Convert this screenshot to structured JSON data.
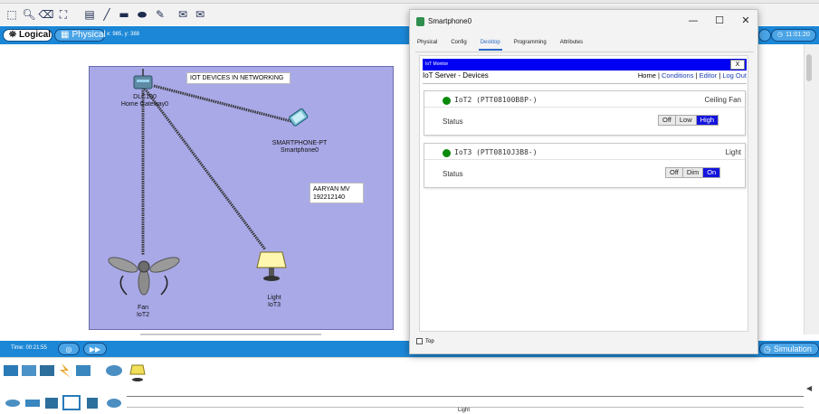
{
  "workspace": {
    "tabs": {
      "logical": "Logical",
      "physical": "Physical"
    },
    "coords": "x: 985, y: 388",
    "clock": "11:01:20",
    "title_note": "IOT DEVICES IN NETWORKING",
    "name_note": [
      "AARYAN MV",
      "192212140"
    ],
    "devices": {
      "gateway": {
        "type": "DLC100",
        "name": "Home Gateway0"
      },
      "smartphone": {
        "type": "SMARTPHONE-PT",
        "name": "Smartphone0"
      },
      "fan": {
        "type": "Fan",
        "name": "IoT2"
      },
      "light": {
        "type": "Light",
        "name": "IoT3"
      }
    }
  },
  "bottom_bar": {
    "time": "Time: 00:21:55",
    "mode": "Simulation"
  },
  "palette": {
    "selected_label": "Light"
  },
  "phone_window": {
    "title": "Smartphone0",
    "controls": {
      "minimize": "—",
      "maximize": "☐",
      "close": "✕"
    },
    "tabs": [
      "Physical",
      "Config",
      "Desktop",
      "Programming",
      "Attributes"
    ],
    "active_tab": "Desktop",
    "top_checkbox_label": "Top",
    "iot_monitor": {
      "title": "IoT Monitor",
      "close": "X",
      "header": "IoT Server - Devices",
      "nav": {
        "home": "Home",
        "conditions": "Conditions",
        "editor": "Editor",
        "logout": "Log Out"
      },
      "devices": [
        {
          "name": "IoT2 (PTT08100B8P-)",
          "type": "Ceiling Fan",
          "status_label": "Status",
          "options": [
            "Off",
            "Low",
            "High"
          ],
          "selected": "High"
        },
        {
          "name": "IoT3 (PTT0810J3B8-)",
          "type": "Light",
          "status_label": "Status",
          "options": [
            "Off",
            "Dim",
            "On"
          ],
          "selected": "On"
        }
      ]
    }
  },
  "colors": {
    "accent_blue": "#1b87d6",
    "cluster": "#a9a9e8",
    "iot_bar": "#0000f2",
    "active_state": "#1414dd",
    "online_dot": "#0a8a0a"
  }
}
